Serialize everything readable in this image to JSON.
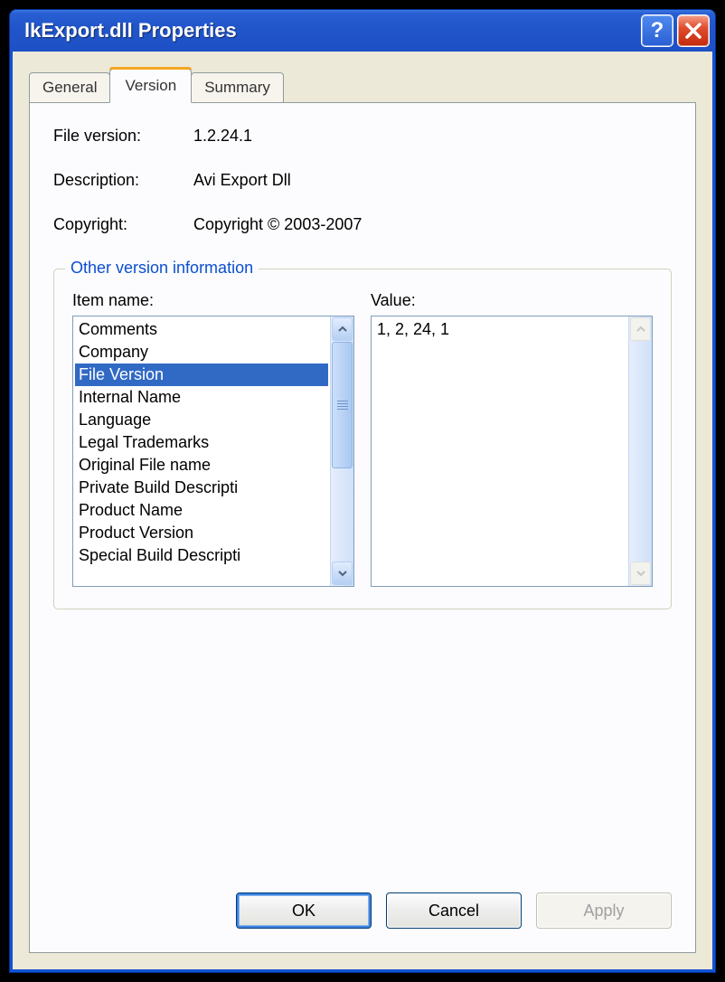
{
  "titlebar": {
    "title": "lkExport.dll Properties"
  },
  "tabs": {
    "general": "General",
    "version": "Version",
    "summary": "Summary",
    "active": "version"
  },
  "info": {
    "file_version_label": "File version:",
    "file_version_value": "1.2.24.1",
    "description_label": "Description:",
    "description_value": "Avi Export Dll",
    "copyright_label": "Copyright:",
    "copyright_value": "Copyright © 2003-2007"
  },
  "groupbox": {
    "title": "Other version information",
    "item_name_label": "Item name:",
    "value_label": "Value:",
    "items": [
      "Comments",
      "Company",
      "File Version",
      "Internal Name",
      "Language",
      "Legal Trademarks",
      "Original File name",
      "Private Build Descripti",
      "Product Name",
      "Product Version",
      "Special Build Descripti"
    ],
    "selected_index": 2,
    "value_text": "1, 2, 24, 1"
  },
  "buttons": {
    "ok": "OK",
    "cancel": "Cancel",
    "apply": "Apply"
  }
}
